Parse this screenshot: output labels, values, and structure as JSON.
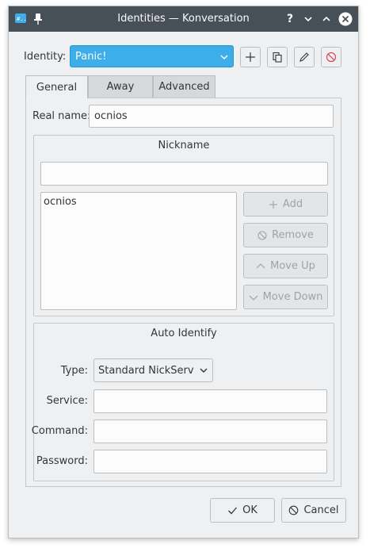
{
  "window": {
    "title": "Identities — Konversation"
  },
  "identity": {
    "label": "Identity:",
    "selected": "Panic!"
  },
  "tabs": [
    {
      "label": "General"
    },
    {
      "label": "Away"
    },
    {
      "label": "Advanced"
    }
  ],
  "general": {
    "realname_label": "Real name:",
    "realname_value": "ocnios",
    "nickname": {
      "title": "Nickname",
      "input_value": "",
      "list": [
        "ocnios"
      ],
      "add_label": "Add",
      "remove_label": "Remove",
      "moveup_label": "Move Up",
      "movedown_label": "Move Down"
    },
    "auto_identify": {
      "title": "Auto Identify",
      "type_label": "Type:",
      "type_value": "Standard NickServ",
      "service_label": "Service:",
      "service_value": "",
      "command_label": "Command:",
      "command_value": "",
      "password_label": "Password:",
      "password_value": ""
    }
  },
  "footer": {
    "ok_label": "OK",
    "cancel_label": "Cancel"
  }
}
